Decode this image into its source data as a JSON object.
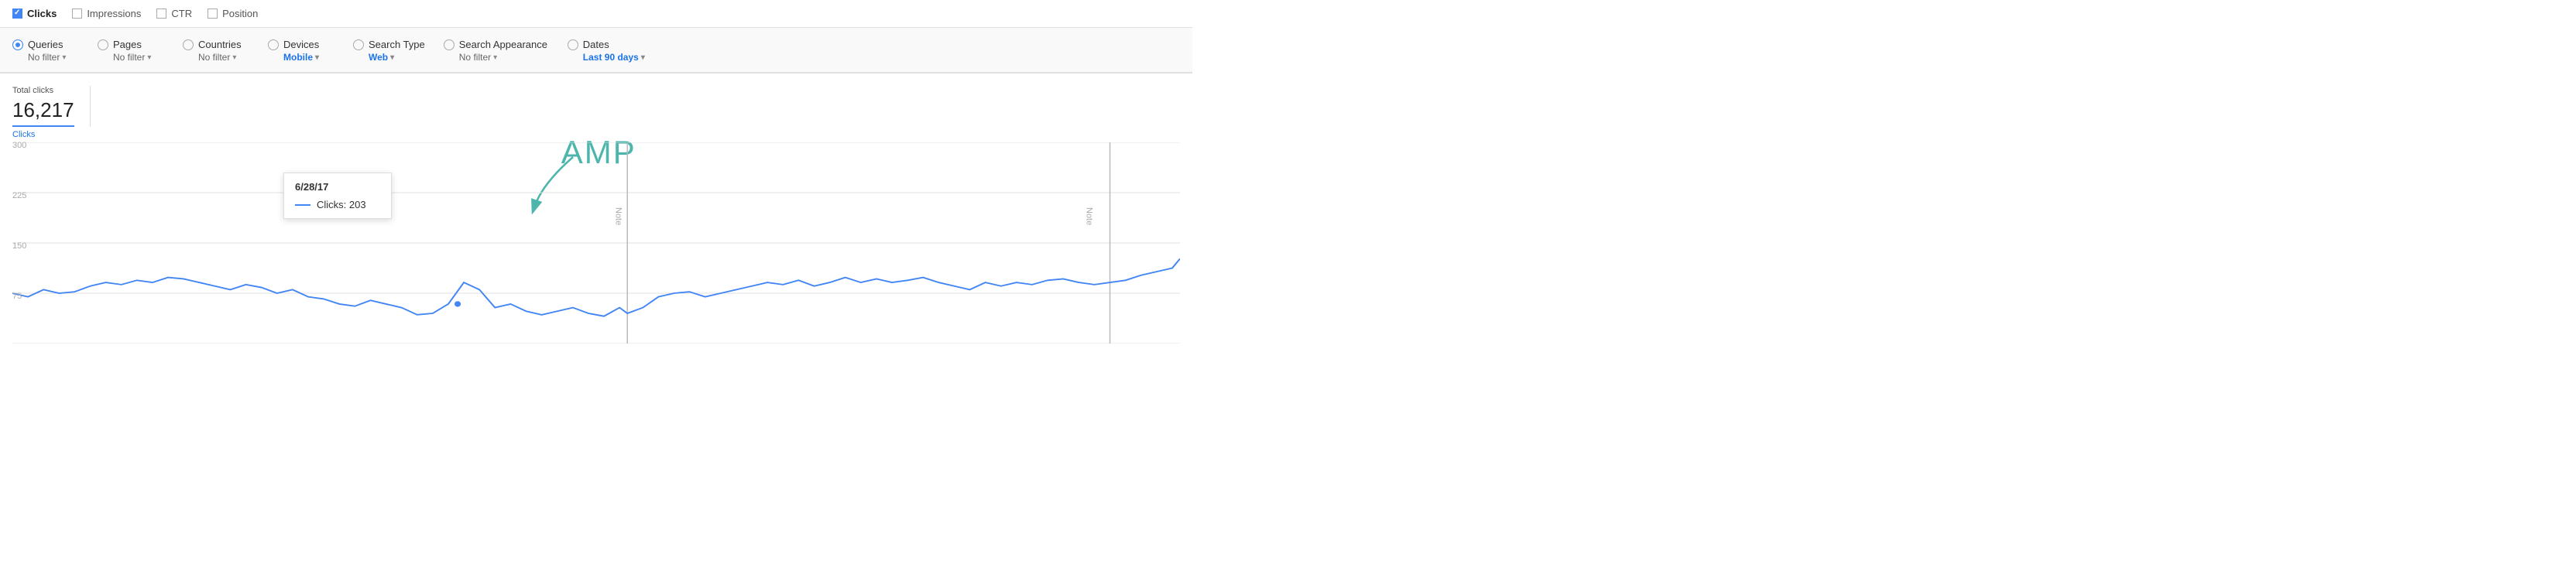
{
  "metrics": {
    "clicks": {
      "label": "Clicks",
      "checked": true
    },
    "impressions": {
      "label": "Impressions",
      "checked": false
    },
    "ctr": {
      "label": "CTR",
      "checked": false
    },
    "position": {
      "label": "Position",
      "checked": false
    }
  },
  "filters": [
    {
      "id": "queries",
      "label": "Queries",
      "sub": "No filter",
      "selected": true,
      "subBold": false
    },
    {
      "id": "pages",
      "label": "Pages",
      "sub": "No filter",
      "selected": false,
      "subBold": false
    },
    {
      "id": "countries",
      "label": "Countries",
      "sub": "No filter",
      "selected": false,
      "subBold": false
    },
    {
      "id": "devices",
      "label": "Devices",
      "sub": "Mobile",
      "selected": false,
      "subBold": true
    },
    {
      "id": "search-type",
      "label": "Search Type",
      "sub": "Web",
      "selected": false,
      "subBold": true
    },
    {
      "id": "search-appearance",
      "label": "Search Appearance",
      "sub": "No filter",
      "selected": false,
      "subBold": false
    },
    {
      "id": "dates",
      "label": "Dates",
      "sub": "Last 90 days",
      "selected": false,
      "subBold": true
    }
  ],
  "chart": {
    "title": "Total clicks",
    "value": "16,217",
    "clicks_label": "Clicks",
    "y_labels": [
      "300",
      "225",
      "150",
      "75"
    ],
    "amp_text": "AMP",
    "tooltip": {
      "date": "6/28/17",
      "metric": "Clicks",
      "value": "203"
    },
    "note_labels": [
      "Note",
      "Note"
    ]
  }
}
